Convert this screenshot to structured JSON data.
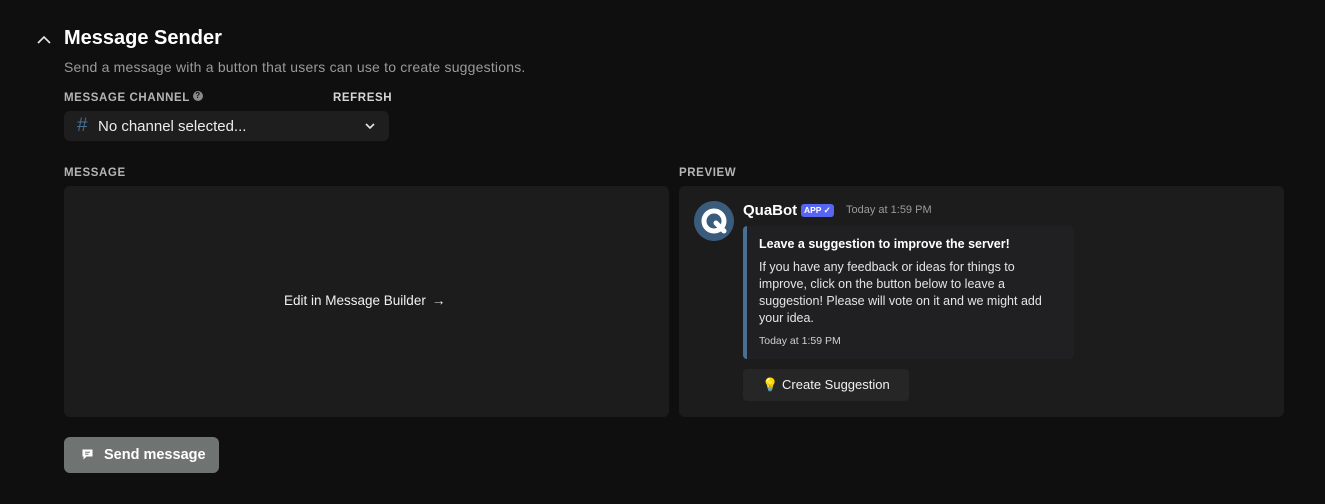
{
  "section": {
    "title": "Message Sender",
    "subtitle": "Send a message with a button that users can use to create suggestions."
  },
  "channel": {
    "label": "MESSAGE CHANNEL",
    "refresh_label": "REFRESH",
    "selected_value": "No channel selected..."
  },
  "message": {
    "label": "MESSAGE",
    "edit_link": "Edit in Message Builder",
    "edit_arrow": "→"
  },
  "preview": {
    "label": "PREVIEW",
    "author": "QuaBot",
    "badge": "APP ✓",
    "timestamp": "Today at 1:59 PM",
    "embed_title": "Leave a suggestion to improve the server!",
    "embed_description": "If you have any feedback or ideas for things to improve, click on the button below to leave a suggestion! Please will vote on it and we might add your idea.",
    "embed_footer": "Today at 1:59 PM",
    "button_label": "💡 Create Suggestion"
  },
  "send_button": {
    "label": "Send message"
  },
  "colors": {
    "accent": "#4a6f94",
    "badge": "#5865f2",
    "send_button": "#6f7472",
    "background": "#0f0f10"
  }
}
